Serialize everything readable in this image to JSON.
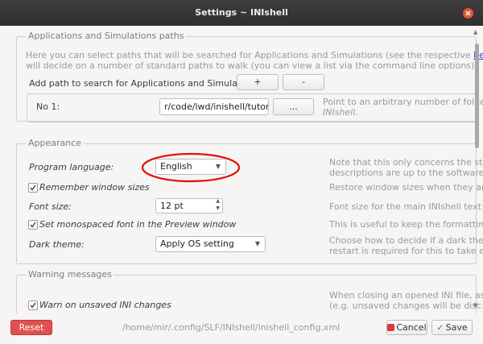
{
  "window": {
    "title": "Settings ~ INIshell"
  },
  "sections": {
    "paths": {
      "title": "Applications and Simulations paths",
      "desc_line1_pre": "Here you can select paths that will be searched for Applications and Simulations (see the respective",
      "desc_link": "help file pages",
      "desc_line1_post": ").",
      "desc_line2": "will decide on a number of standard paths to walk (you can view a list via the command line options).",
      "add_label": "Add path to search for Applications and Simulations:",
      "add_button": "+",
      "remove_button": "-",
      "entry_label": "No 1:",
      "entry_value": "r/code/lwd/inishell/tutorial",
      "browse_button": "...",
      "help_line1": "Point to an arbitrary number of folde",
      "help_line2": "INIshell."
    },
    "appearance": {
      "title": "Appearance",
      "language_label": "Program language:",
      "language_value": "English",
      "language_help_line1": "Note that this only concerns the stat",
      "language_help_line2": "descriptions are up to the software's",
      "remember_label": "Remember window sizes",
      "remember_checked": true,
      "remember_help": "Restore window sizes when they are",
      "font_label": "Font size:",
      "font_value": "12 pt",
      "font_help": "Font size for the main INIshell text e",
      "mono_label": "Set monospaced font in the Preview window",
      "mono_checked": true,
      "mono_help": "This is useful to keep the formatting",
      "theme_label": "Dark theme:",
      "theme_value": "Apply OS setting",
      "theme_help_line1": "Choose how to decide if a dark theme",
      "theme_help_line2": "restart is required for this to take ef"
    },
    "warnings": {
      "title": "Warning messages",
      "unsaved_label": "Warn on unsaved INI changes",
      "unsaved_checked": true,
      "help_line1": "When closing an opened INI file, ask",
      "help_line2": "(e.g. unsaved changes will be disc"
    }
  },
  "footer": {
    "reset_button": "Reset",
    "config_path": "/home/mir/.config/SLF/INIshell/inishell_config.xml",
    "cancel_button": "Cancel",
    "save_button": "Save"
  },
  "colors": {
    "reset_bg": "#e05050",
    "link": "#1a50c8",
    "highlight_ellipse": "#e01010",
    "titlebar": "#353535"
  }
}
